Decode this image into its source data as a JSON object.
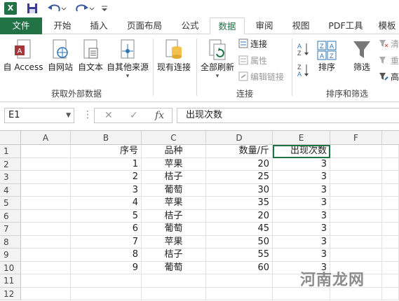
{
  "qat": {
    "logo": "X"
  },
  "tabs": [
    {
      "label": "文件"
    },
    {
      "label": "开始"
    },
    {
      "label": "插入"
    },
    {
      "label": "页面布局"
    },
    {
      "label": "公式"
    },
    {
      "label": "数据"
    },
    {
      "label": "审阅"
    },
    {
      "label": "视图"
    },
    {
      "label": "PDF工具"
    },
    {
      "label": "模板"
    }
  ],
  "ribbon": {
    "external_data": {
      "group_label": "获取外部数据",
      "buttons": [
        "自 Access",
        "自网站",
        "自文本",
        "自其他来源"
      ]
    },
    "existing_conn": {
      "label": "现有连接"
    },
    "connections": {
      "group_label": "连接",
      "refresh_label": "全部刷新",
      "items": [
        "连接",
        "属性",
        "编辑链接"
      ]
    },
    "sort_filter": {
      "group_label": "排序和筛选",
      "sort_label": "排序",
      "filter_label": "筛选",
      "clear_label": "清",
      "reapply_label": "重",
      "advanced_label": "高"
    }
  },
  "formula_bar": {
    "name_box": "E1",
    "fx": "fx",
    "content": "出现次数"
  },
  "columns": [
    "A",
    "B",
    "C",
    "D",
    "E",
    "F"
  ],
  "rows": [
    "1",
    "2",
    "3",
    "4",
    "5",
    "6",
    "7",
    "8",
    "9",
    "10",
    "11",
    "12"
  ],
  "table": {
    "header": [
      "序号",
      "品种",
      "数量/斤",
      "出现次数"
    ],
    "data": [
      [
        "1",
        "苹果",
        "20",
        "3"
      ],
      [
        "2",
        "桔子",
        "25",
        "3"
      ],
      [
        "3",
        "葡萄",
        "30",
        "3"
      ],
      [
        "4",
        "苹果",
        "35",
        "3"
      ],
      [
        "5",
        "桔子",
        "20",
        "3"
      ],
      [
        "6",
        "葡萄",
        "45",
        "3"
      ],
      [
        "7",
        "苹果",
        "50",
        "3"
      ],
      [
        "8",
        "桔子",
        "55",
        "3"
      ],
      [
        "9",
        "葡萄",
        "60",
        "3"
      ]
    ]
  },
  "watermark": "河南龙网",
  "colors": {
    "excel_green": "#217346"
  }
}
